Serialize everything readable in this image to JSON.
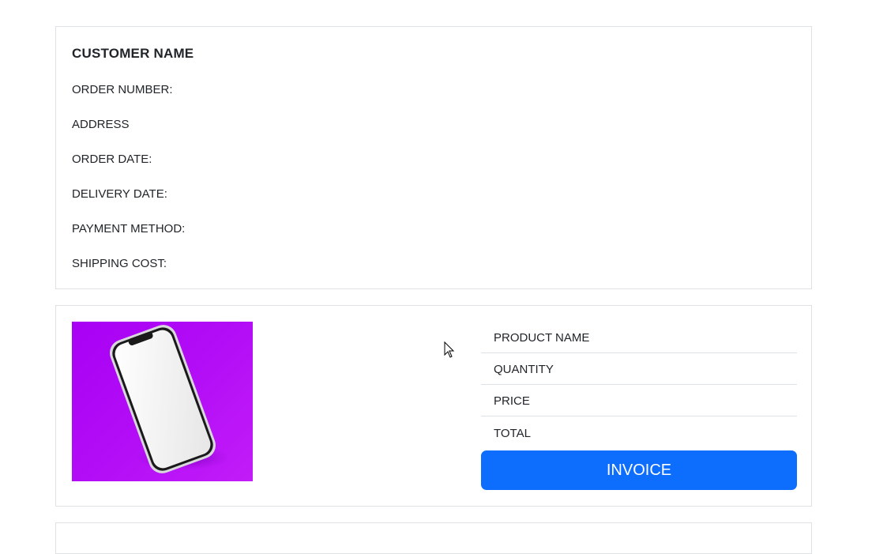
{
  "customer": {
    "name_label": "CUSTOMER NAME",
    "order_number_label": "ORDER NUMBER:",
    "address_label": "ADDRESS",
    "order_date_label": "ORDER DATE:",
    "delivery_date_label": "DELIVERY DATE:",
    "payment_method_label": "PAYMENT METHOD:",
    "shipping_cost_label": "SHIPPING COST:"
  },
  "product": {
    "image_icon": "smartphone-image",
    "name_label": "PRODUCT NAME",
    "quantity_label": "QUANTITY",
    "price_label": "PRICE",
    "total_label": "TOTAL",
    "invoice_button_label": "INVOICE"
  },
  "colors": {
    "accent": "#0d6efd",
    "image_background": "#b40ef7",
    "border": "#dfe2e5"
  }
}
